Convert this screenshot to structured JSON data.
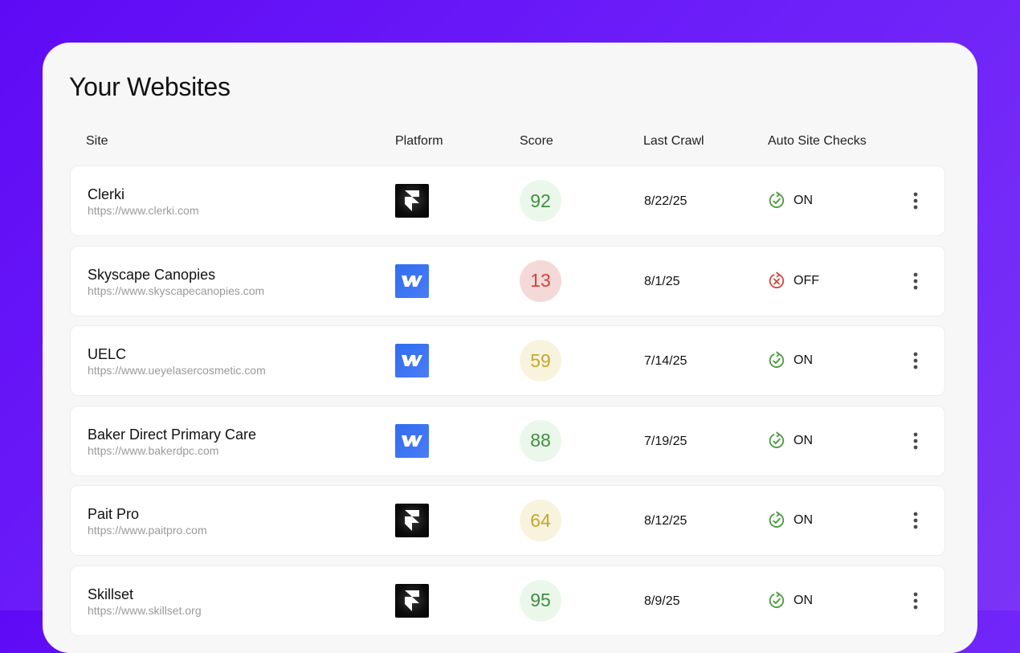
{
  "page": {
    "title": "Your Websites"
  },
  "columns": {
    "site": "Site",
    "platform": "Platform",
    "score": "Score",
    "last_crawl": "Last Crawl",
    "auto_checks": "Auto Site Checks"
  },
  "colors": {
    "background_gradient_start": "#5f0af5",
    "background_gradient_end": "#7b34f6",
    "score_good_bg": "#ecf7ec",
    "score_good_text": "#3f8f3f",
    "score_bad_bg": "#f5d9d9",
    "score_bad_text": "#d0443c",
    "score_mid_bg": "#f7f3dd",
    "score_mid_text": "#c4a82e",
    "status_on": "#4a9a3c",
    "status_off": "#d9443c"
  },
  "sites": [
    {
      "name": "Clerki",
      "url": "https://www.clerki.com",
      "platform": "framer",
      "platform_icon": "framer-logo-icon",
      "score": "92",
      "score_level": "good",
      "last_crawl": "8/22/25",
      "auto_checks": "ON"
    },
    {
      "name": "Skyscape Canopies",
      "url": "https://www.skyscapecanopies.com",
      "platform": "webflow",
      "platform_icon": "webflow-logo-icon",
      "score": "13",
      "score_level": "bad",
      "last_crawl": "8/1/25",
      "auto_checks": "OFF"
    },
    {
      "name": "UELC",
      "url": "https://www.ueyelasercosmetic.com",
      "platform": "webflow",
      "platform_icon": "webflow-logo-icon",
      "score": "59",
      "score_level": "mid",
      "last_crawl": "7/14/25",
      "auto_checks": "ON"
    },
    {
      "name": "Baker Direct Primary Care",
      "url": "https://www.bakerdpc.com",
      "platform": "webflow",
      "platform_icon": "webflow-logo-icon",
      "score": "88",
      "score_level": "good",
      "last_crawl": "7/19/25",
      "auto_checks": "ON"
    },
    {
      "name": "Pait Pro",
      "url": "https://www.paitpro.com",
      "platform": "framer",
      "platform_icon": "framer-logo-icon",
      "score": "64",
      "score_level": "mid",
      "last_crawl": "8/12/25",
      "auto_checks": "ON"
    },
    {
      "name": "Skillset",
      "url": "https://www.skillset.org",
      "platform": "framer",
      "platform_icon": "framer-logo-icon",
      "score": "95",
      "score_level": "good",
      "last_crawl": "8/9/25",
      "auto_checks": "ON"
    }
  ]
}
